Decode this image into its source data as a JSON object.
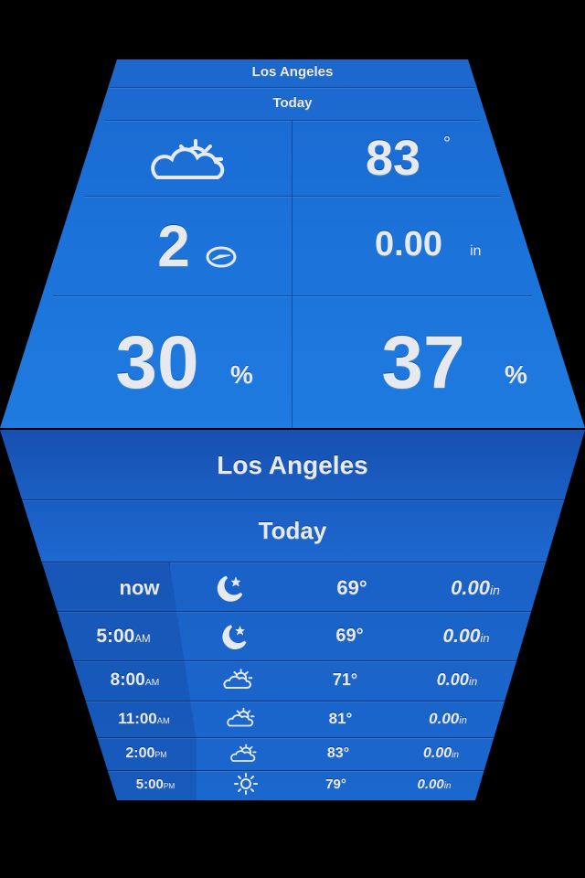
{
  "top": {
    "city": "Los Angeles",
    "period": "Today",
    "temperature": "83",
    "degree_symbol": "°",
    "wind_speed": "2",
    "precip_amount": "0.00",
    "precip_unit": "in",
    "humidity_value": "30",
    "humidity_unit": "%",
    "chance_value": "37",
    "chance_unit": "%",
    "weather_icon": "partly-cloudy-sun-icon",
    "wind_icon": "wind-direction-icon"
  },
  "front": {
    "city": "Los Angeles",
    "period": "Today",
    "rows": [
      {
        "time": "now",
        "ampm": "",
        "icon": "moon-stars-icon",
        "temp": "69°",
        "precip": "0.00",
        "unit": "in"
      },
      {
        "time": "5:00",
        "ampm": "AM",
        "icon": "moon-stars-icon",
        "temp": "69°",
        "precip": "0.00",
        "unit": "in"
      },
      {
        "time": "8:00",
        "ampm": "AM",
        "icon": "partly-cloudy-sun-icon",
        "temp": "71°",
        "precip": "0.00",
        "unit": "in"
      },
      {
        "time": "11:00",
        "ampm": "AM",
        "icon": "partly-cloudy-sun-icon",
        "temp": "81°",
        "precip": "0.00",
        "unit": "in"
      },
      {
        "time": "2:00",
        "ampm": "PM",
        "icon": "partly-cloudy-sun-icon",
        "temp": "83°",
        "precip": "0.00",
        "unit": "in"
      },
      {
        "time": "5:00",
        "ampm": "PM",
        "icon": "sun-icon",
        "temp": "79°",
        "precip": "0.00",
        "unit": "in"
      }
    ]
  },
  "colors": {
    "face": "#1a6fd6",
    "text": "#e6eaf0",
    "background": "#000000"
  }
}
